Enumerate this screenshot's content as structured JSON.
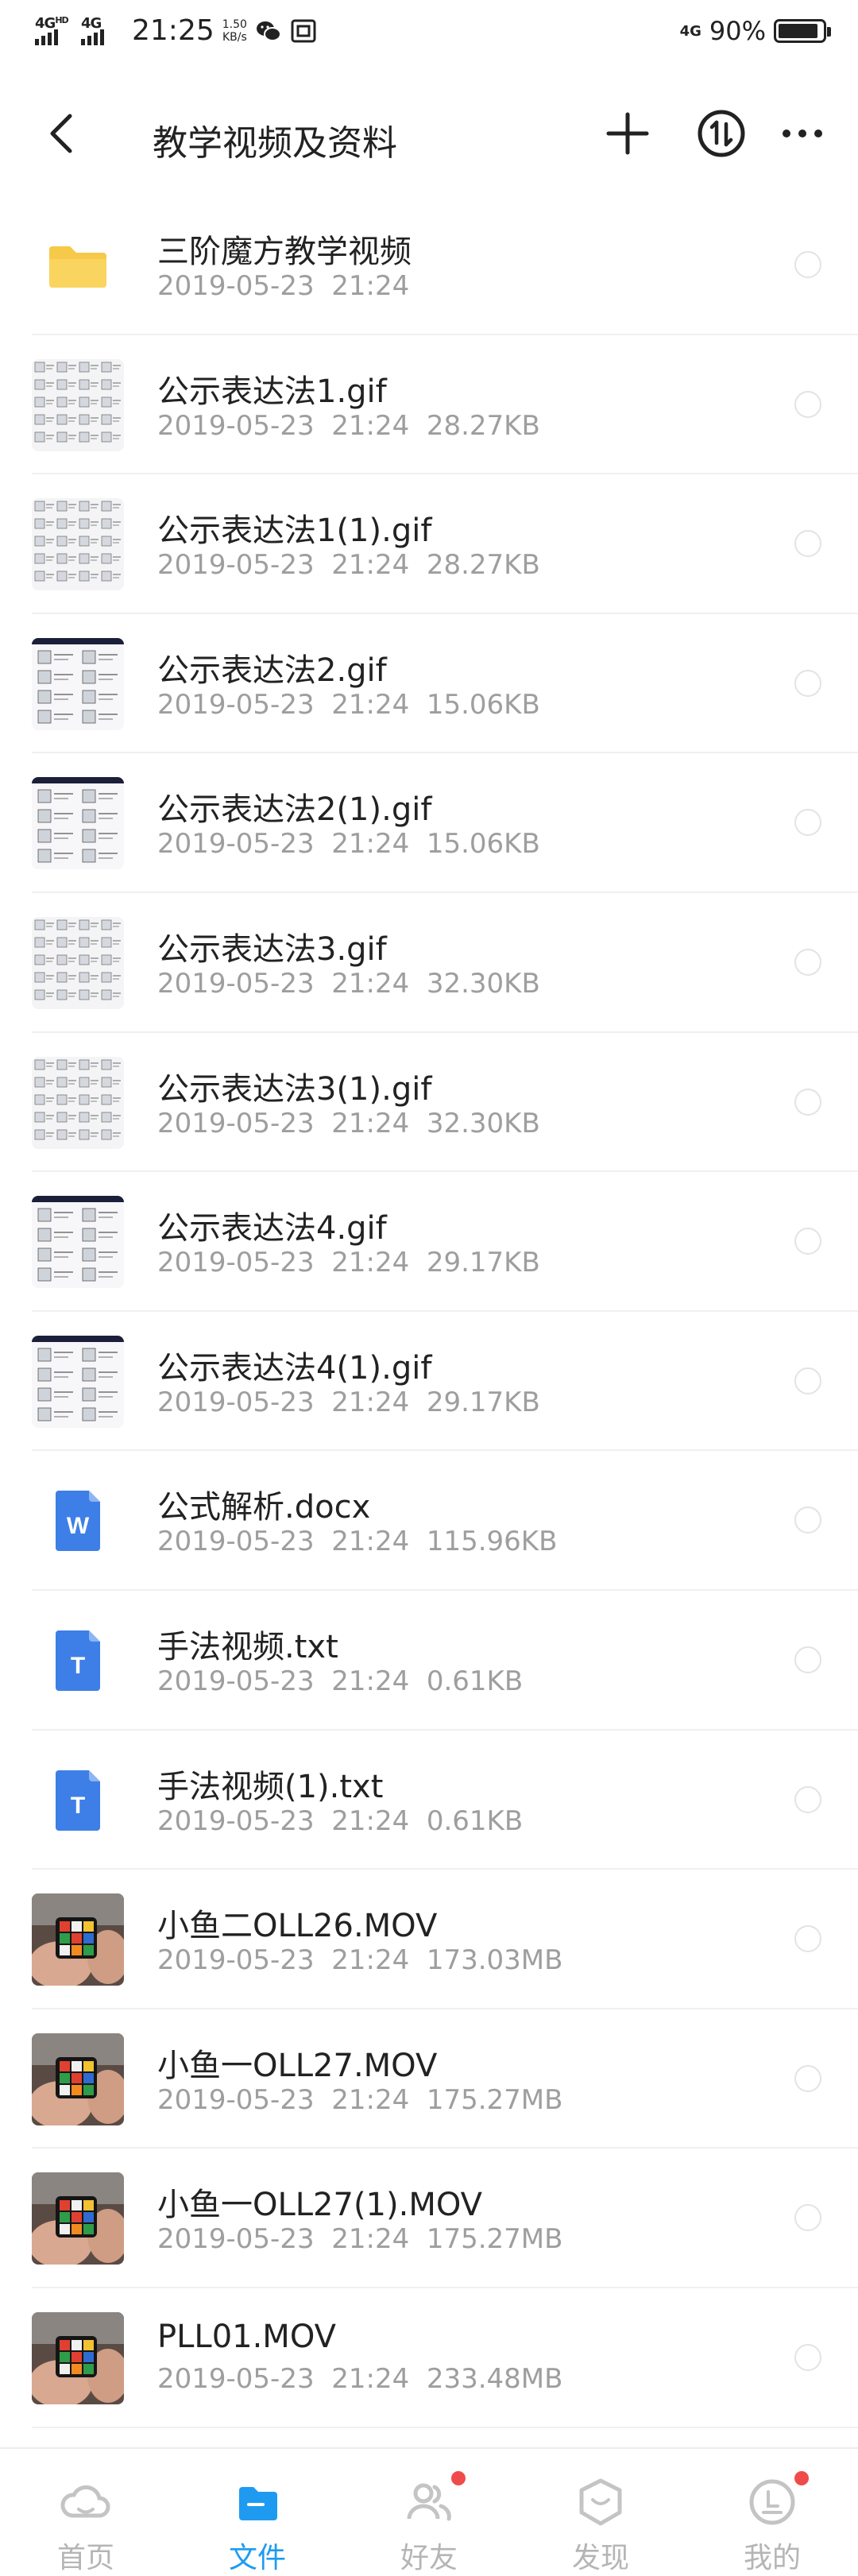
{
  "status_bar": {
    "net1_label": "4G",
    "net1_hd": "HD",
    "net2_label": "4G",
    "time": "21:25",
    "speed_value": "1.50",
    "speed_unit": "KB/s",
    "net_right": "4G",
    "battery": "90%",
    "battery_level": 0.9
  },
  "nav": {
    "title": "教学视频及资料"
  },
  "files": [
    {
      "name": "三阶魔方教学视频",
      "date": "2019-05-23",
      "time": "21:24",
      "size": "",
      "kind": "folder"
    },
    {
      "name": "公示表达法1.gif",
      "date": "2019-05-23",
      "time": "21:24",
      "size": "28.27KB",
      "kind": "gif-grid"
    },
    {
      "name": "公示表达法1(1).gif",
      "date": "2019-05-23",
      "time": "21:24",
      "size": "28.27KB",
      "kind": "gif-grid"
    },
    {
      "name": "公示表达法2.gif",
      "date": "2019-05-23",
      "time": "21:24",
      "size": "15.06KB",
      "kind": "gif-dark"
    },
    {
      "name": "公示表达法2(1).gif",
      "date": "2019-05-23",
      "time": "21:24",
      "size": "15.06KB",
      "kind": "gif-dark"
    },
    {
      "name": "公示表达法3.gif",
      "date": "2019-05-23",
      "time": "21:24",
      "size": "32.30KB",
      "kind": "gif-grid"
    },
    {
      "name": "公示表达法3(1).gif",
      "date": "2019-05-23",
      "time": "21:24",
      "size": "32.30KB",
      "kind": "gif-grid"
    },
    {
      "name": "公示表达法4.gif",
      "date": "2019-05-23",
      "time": "21:24",
      "size": "29.17KB",
      "kind": "gif-dark"
    },
    {
      "name": "公示表达法4(1).gif",
      "date": "2019-05-23",
      "time": "21:24",
      "size": "29.17KB",
      "kind": "gif-dark"
    },
    {
      "name": "公式解析.docx",
      "date": "2019-05-23",
      "time": "21:24",
      "size": "115.96KB",
      "kind": "word",
      "icon_letter": "W"
    },
    {
      "name": "手法视频.txt",
      "date": "2019-05-23",
      "time": "21:24",
      "size": "0.61KB",
      "kind": "txt",
      "icon_letter": "T"
    },
    {
      "name": "手法视频(1).txt",
      "date": "2019-05-23",
      "time": "21:24",
      "size": "0.61KB",
      "kind": "txt",
      "icon_letter": "T"
    },
    {
      "name": "小鱼二OLL26.MOV",
      "date": "2019-05-23",
      "time": "21:24",
      "size": "173.03MB",
      "kind": "video"
    },
    {
      "name": "小鱼一OLL27.MOV",
      "date": "2019-05-23",
      "time": "21:24",
      "size": "175.27MB",
      "kind": "video"
    },
    {
      "name": "小鱼一OLL27(1).MOV",
      "date": "2019-05-23",
      "time": "21:24",
      "size": "175.27MB",
      "kind": "video"
    },
    {
      "name": "PLL01.MOV",
      "date": "2019-05-23",
      "time": "21:24",
      "size": "233.48MB",
      "kind": "video"
    }
  ],
  "tabs": [
    {
      "label": "首页",
      "icon": "cloud-home-icon",
      "active": false,
      "dot": false
    },
    {
      "label": "文件",
      "icon": "folder-icon",
      "active": true,
      "dot": false
    },
    {
      "label": "好友",
      "icon": "friends-icon",
      "active": false,
      "dot": true
    },
    {
      "label": "发现",
      "icon": "discover-icon",
      "active": false,
      "dot": false
    },
    {
      "label": "我的",
      "icon": "profile-icon",
      "active": false,
      "dot": true
    }
  ],
  "colors": {
    "accent": "#1e9bf0",
    "folder": "#f7c948",
    "doc_icon": "#3d7fe6",
    "badge": "#f04b4b",
    "meta_text": "#9e9e9e"
  }
}
